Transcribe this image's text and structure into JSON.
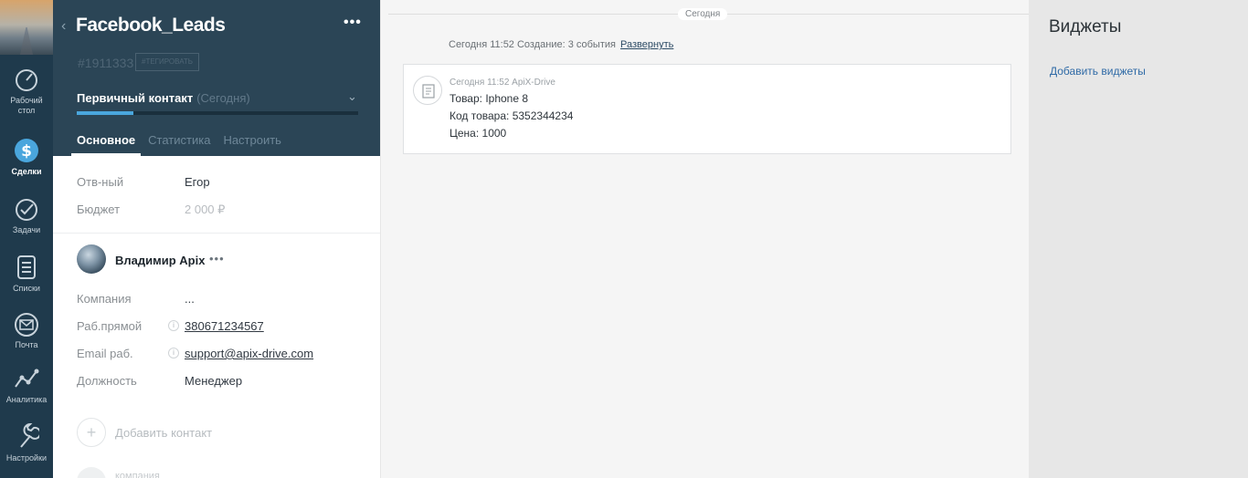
{
  "rail": {
    "items": [
      {
        "label": "Рабочий\nстол",
        "icon": "dashboard-icon"
      },
      {
        "label": "Сделки",
        "icon": "deals-icon",
        "active": true
      },
      {
        "label": "Задачи",
        "icon": "tasks-icon"
      },
      {
        "label": "Списки",
        "icon": "lists-icon"
      },
      {
        "label": "Почта",
        "icon": "mail-icon"
      },
      {
        "label": "Аналитика",
        "icon": "analytics-icon"
      },
      {
        "label": "Настройки",
        "icon": "settings-icon"
      }
    ]
  },
  "lead": {
    "title": "Facebook_Leads",
    "id": "#1911333",
    "tag_button": "#ТЕГИРОВАТЬ",
    "stage": "Первичный контакт",
    "stage_date": "(Сегодня)",
    "tabs": [
      "Основное",
      "Статистика",
      "Настроить"
    ],
    "fields": [
      {
        "label": "Отв-ный",
        "value": "Егор"
      },
      {
        "label": "Бюджет",
        "value": "2 000 ₽"
      }
    ]
  },
  "contact": {
    "name": "Владимир Apix",
    "fields": [
      {
        "label": "Компания",
        "value": "..."
      },
      {
        "label": "Раб.прямой",
        "value": "380671234567"
      },
      {
        "label": "Email раб.",
        "value": "support@apix-drive.com"
      },
      {
        "label": "Должность",
        "value": "Менеджер"
      }
    ],
    "add_contact_label": "Добавить контакт",
    "company_stub_label": "компания"
  },
  "feed": {
    "day_label": "Сегодня",
    "summary": "Сегодня 11:52 Создание: 3 события",
    "expand_label": "Развернуть",
    "note": {
      "meta": "Сегодня 11:52 ApiX-Drive",
      "lines": [
        "Товар: Iphone 8",
        "Код товара: 5352344234",
        "Цена: 1000"
      ]
    }
  },
  "widgets": {
    "title": "Виджеты",
    "add_label": "Добавить виджеты"
  },
  "colors": {
    "rail_bg": "#1f3a4c",
    "header_bg": "#2b4556",
    "accent": "#4aa6dd",
    "link": "#2f6aa6"
  }
}
